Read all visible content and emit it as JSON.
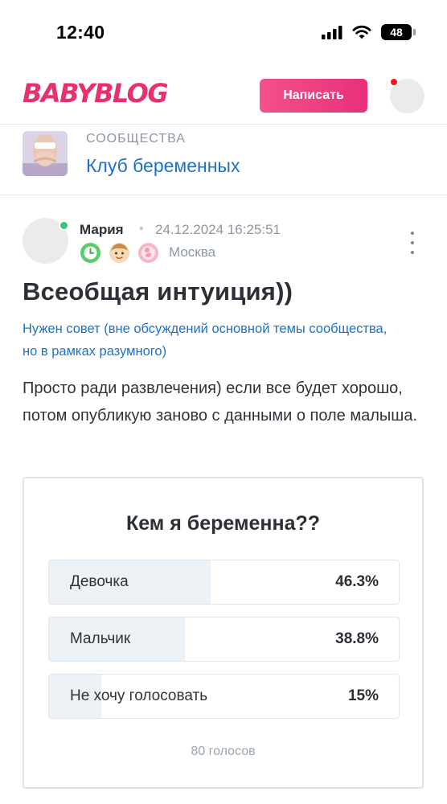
{
  "status_bar": {
    "time": "12:40",
    "battery": "48"
  },
  "header": {
    "logo": "BABYBLOG",
    "write_button": "Написать"
  },
  "community": {
    "caption": "СООБЩЕСТВА",
    "name": "Клуб беременных"
  },
  "post": {
    "author": "Мария",
    "separator": "•",
    "date": "24.12.2024 16:25:51",
    "location": "Москва",
    "title": "Всеобщая интуиция))",
    "rubric": "Нужен совет (вне обсуждений основной темы сообщества, но в рамках разумного)",
    "text": "Просто ради развлечения) если все будет хорошо, потом опубликую заново с данными о поле малыша."
  },
  "poll": {
    "question": "Кем я беременна??",
    "options": [
      {
        "label": "Девочка",
        "percent": "46.3%",
        "share": 46.3
      },
      {
        "label": "Мальчик",
        "percent": "38.8%",
        "share": 38.8
      },
      {
        "label": "Не хочу голосовать",
        "percent": "15%",
        "share": 15
      }
    ],
    "votes": "80 голосов"
  },
  "colors": {
    "brand_pink": "#e8306f",
    "link_blue": "#1a73c9",
    "online_green": "#35c47a",
    "notification_red": "#ff0f1f"
  }
}
